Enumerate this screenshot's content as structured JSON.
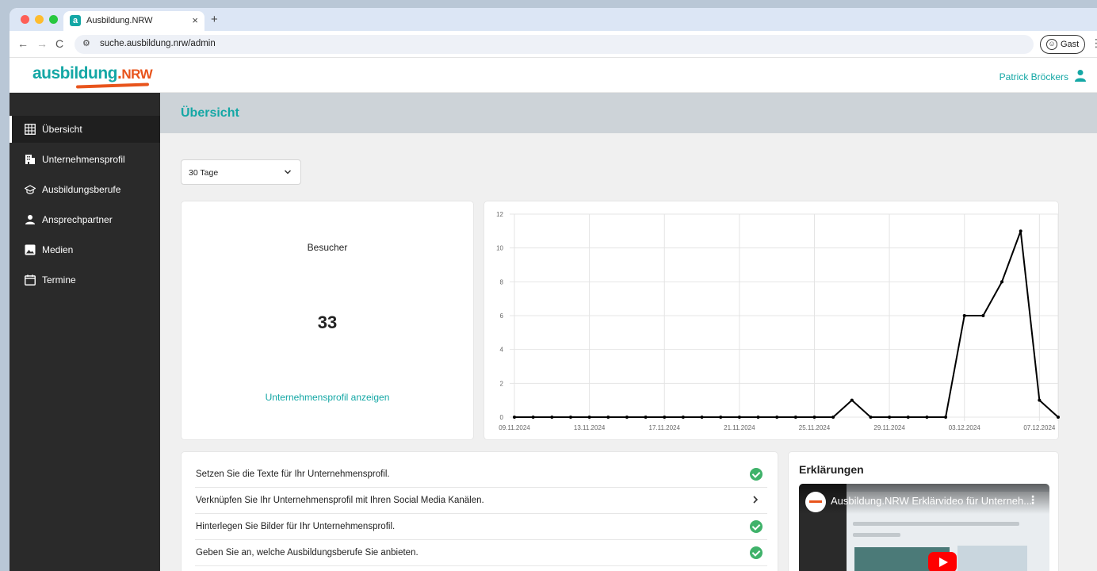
{
  "browser": {
    "tab_title": "Ausbildung.NRW",
    "tab_favicon": "a",
    "tab_close": "×",
    "new_tab": "+",
    "url": "suche.ausbildung.nrw/admin",
    "guest_label": "Gast",
    "back_icon": "←",
    "forward_icon": "→",
    "reload_icon": "C",
    "menu_icon": "⋮"
  },
  "header": {
    "logo_main": "ausbildung",
    "logo_dot": ".",
    "logo_suffix": "NRW",
    "user_name": "Patrick Bröckers"
  },
  "sidebar": {
    "items": [
      {
        "label": "Übersicht",
        "icon": "grid-icon"
      },
      {
        "label": "Unternehmensprofil",
        "icon": "building-icon"
      },
      {
        "label": "Ausbildungsberufe",
        "icon": "graduation-cap-icon"
      },
      {
        "label": "Ansprechpartner",
        "icon": "person-icon"
      },
      {
        "label": "Medien",
        "icon": "image-icon"
      },
      {
        "label": "Termine",
        "icon": "calendar-icon"
      }
    ]
  },
  "main": {
    "title": "Übersicht",
    "period_select": "30 Tage",
    "visitors": {
      "label": "Besucher",
      "count": "33",
      "link": "Unternehmensprofil anzeigen"
    },
    "todos": [
      {
        "text": "Setzen Sie die Texte für Ihr Unternehmensprofil.",
        "status": "done"
      },
      {
        "text": "Verknüpfen Sie Ihr Unternehmensprofil mit Ihren Social Media Kanälen.",
        "status": "open"
      },
      {
        "text": "Hinterlegen Sie Bilder für Ihr Unternehmensprofil.",
        "status": "done"
      },
      {
        "text": "Geben Sie an, welche Ausbildungsberufe Sie anbieten.",
        "status": "done"
      }
    ],
    "explanations": {
      "title": "Erklärungen",
      "video_title": "Ausbildung.NRW Erklärvideo für Unterneh..."
    }
  },
  "colors": {
    "accent": "#14a7a5",
    "logo_orange": "#e8541c",
    "sidebar_bg": "#2a2a2a",
    "check_green": "#3fb26a"
  },
  "chart_data": {
    "type": "line",
    "x": [
      "09.11.2024",
      "10.11.2024",
      "11.11.2024",
      "12.11.2024",
      "13.11.2024",
      "14.11.2024",
      "15.11.2024",
      "16.11.2024",
      "17.11.2024",
      "18.11.2024",
      "19.11.2024",
      "20.11.2024",
      "21.11.2024",
      "22.11.2024",
      "23.11.2024",
      "24.11.2024",
      "25.11.2024",
      "26.11.2024",
      "27.11.2024",
      "28.11.2024",
      "29.11.2024",
      "30.11.2024",
      "01.12.2024",
      "02.12.2024",
      "03.12.2024",
      "04.12.2024",
      "05.12.2024",
      "06.12.2024",
      "07.12.2024",
      "08.12.2024"
    ],
    "series": [
      {
        "values": [
          0,
          0,
          0,
          0,
          0,
          0,
          0,
          0,
          0,
          0,
          0,
          0,
          0,
          0,
          0,
          0,
          0,
          0,
          1,
          0,
          0,
          0,
          0,
          0,
          6,
          6,
          8,
          11,
          1,
          0
        ]
      }
    ],
    "xticks": [
      "09.11.2024",
      "13.11.2024",
      "17.11.2024",
      "21.11.2024",
      "25.11.2024",
      "29.11.2024",
      "03.12.2024",
      "07.12.2024"
    ],
    "yticks": [
      "0",
      "2",
      "4",
      "6",
      "8",
      "10",
      "12"
    ],
    "ylim": [
      0,
      12
    ],
    "grid": true,
    "line_color": "#000000"
  }
}
